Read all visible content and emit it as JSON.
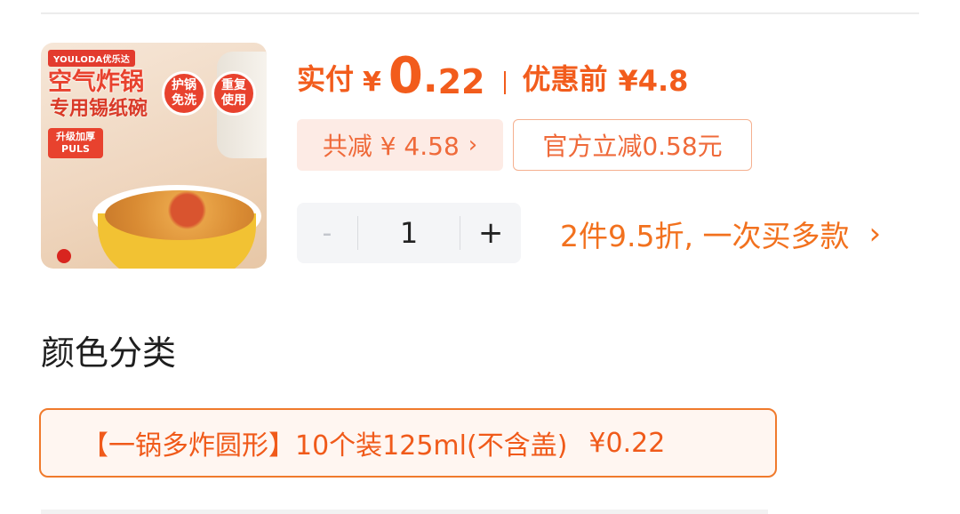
{
  "product": {
    "image": {
      "brand": "YOULODA优乐达",
      "headline": "空气炸锅",
      "subline": "专用锡纸碗",
      "badge_protect": "护锅\n免洗",
      "badge_reuse": "重复\n使用",
      "upgrade": "升级加厚\nPULS"
    }
  },
  "price": {
    "paid_label": "实付",
    "currency": "¥",
    "paid_int": "0",
    "paid_dot": ".",
    "paid_dec": "22",
    "original_label": "优惠前",
    "original_value": "¥4.8"
  },
  "promotions": {
    "total_discount": "共减 ¥ 4.58",
    "total_chevron": "›",
    "official": "官方立减0.58元"
  },
  "quantity": {
    "minus": "-",
    "value": "1",
    "plus": "+"
  },
  "multibuy": {
    "text": "2件9.5折, 一次买多款",
    "chevron": "›"
  },
  "variant": {
    "section_title": "颜色分类",
    "selected_label": "【一锅多炸圆形】10个装125ml(不含盖)",
    "selected_price": "¥0.22"
  },
  "colors": {
    "accent": "#f25c1c",
    "promo_bg": "#fdebe5",
    "stepper_bg": "#f4f5f7"
  }
}
